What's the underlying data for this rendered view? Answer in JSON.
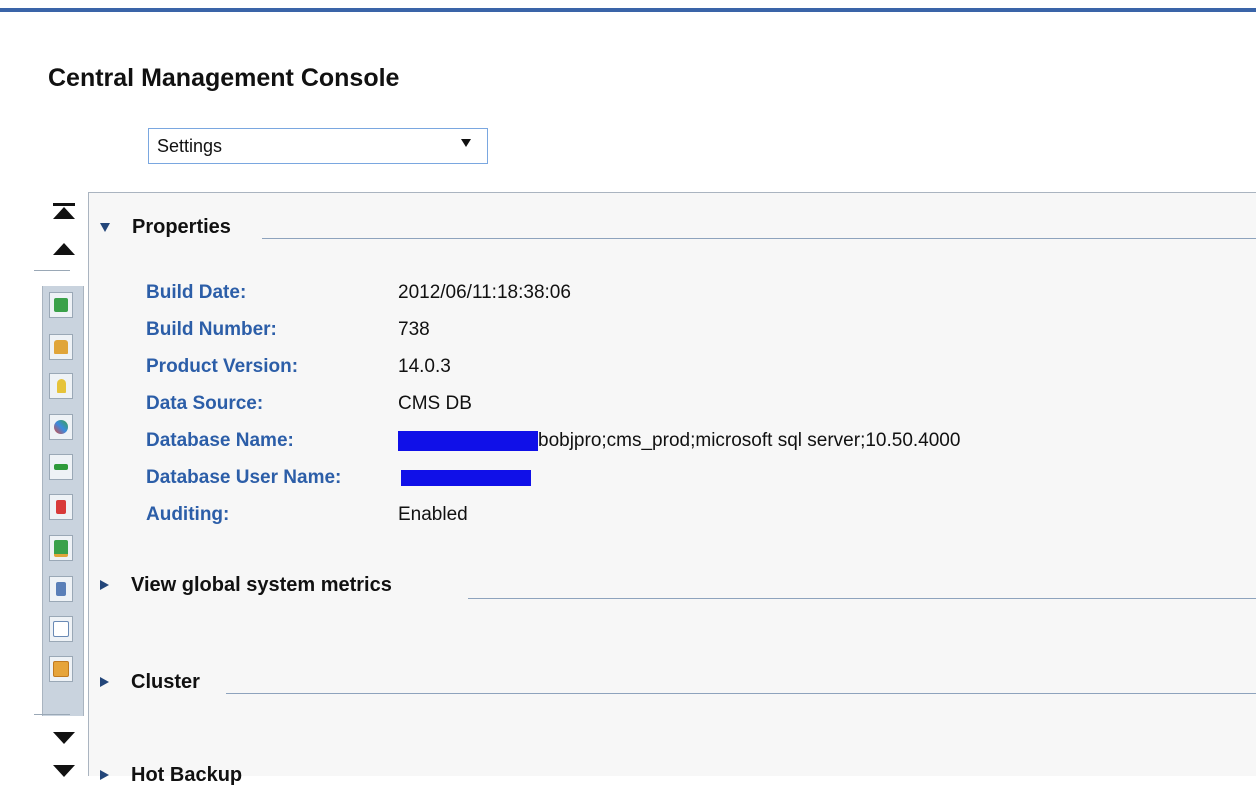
{
  "header": {
    "app_title": "Central Management Console",
    "view_selector": {
      "selected": "Settings"
    }
  },
  "toolbar": {
    "icons": [
      "server-check-icon",
      "lock-icon",
      "key-icon",
      "star-burst-icon",
      "network-icon",
      "document-send-icon",
      "tree-icon",
      "tools-icon",
      "clipboard-icon",
      "grid-icon"
    ]
  },
  "sections": {
    "properties": {
      "title": "Properties",
      "rows": [
        {
          "label": "Build Date:",
          "value": "2012/06/11:18:38:06"
        },
        {
          "label": "Build Number:",
          "value": "738"
        },
        {
          "label": "Product Version:",
          "value": "14.0.3"
        },
        {
          "label": "Data Source:",
          "value": "CMS DB"
        },
        {
          "label": "Database Name:",
          "value": "bobjpro;cms_prod;microsoft sql server;10.50.4000"
        },
        {
          "label": "Database User Name:",
          "value": ""
        },
        {
          "label": "Auditing:",
          "value": "Enabled"
        }
      ]
    },
    "metrics": {
      "title": "View global system metrics"
    },
    "cluster": {
      "title": "Cluster"
    },
    "hot_backup": {
      "title": "Hot Backup"
    }
  },
  "colors": {
    "accent": "#3a64a8",
    "label_blue": "#2c5ea8",
    "redaction": "#1010e8"
  }
}
